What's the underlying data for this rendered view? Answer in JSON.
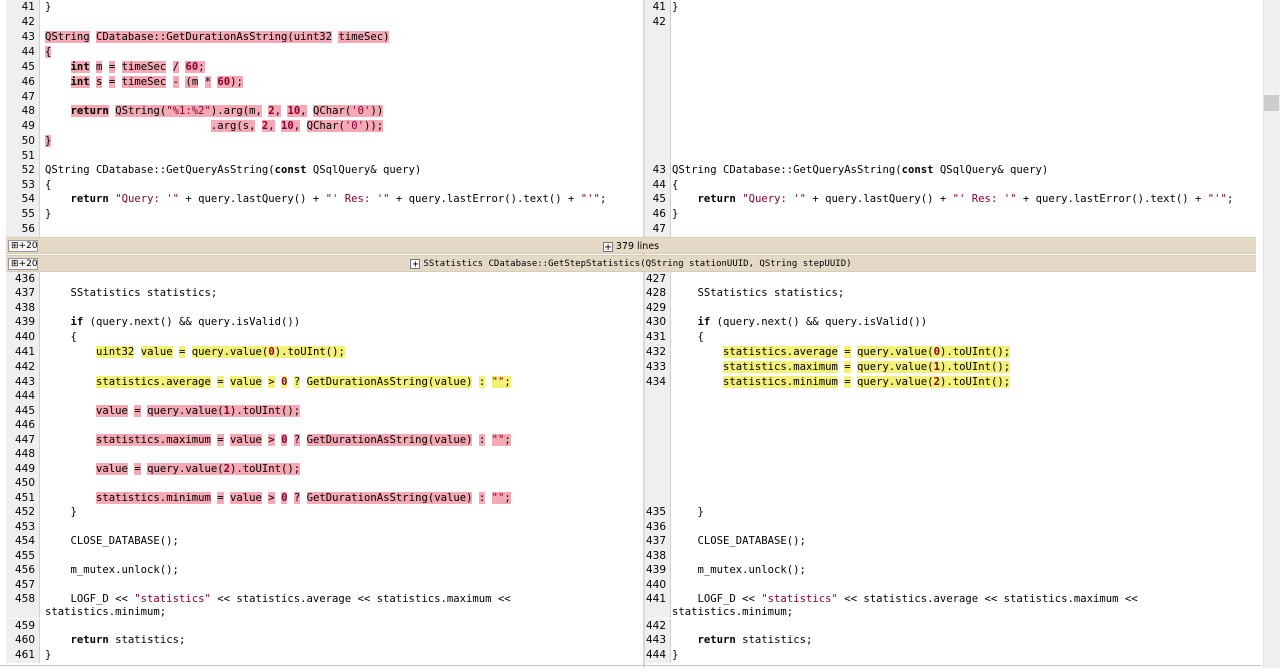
{
  "folds": {
    "top": {
      "expand_label": "+20",
      "text": "379 lines"
    },
    "func": {
      "expand_label": "+20",
      "text": "SStatistics CDatabase::GetStepStatistics(QString stationUUID, QString stepUUID)"
    }
  },
  "left_rows": [
    {
      "ln": "41",
      "text": "}"
    },
    {
      "ln": "42",
      "text": ""
    },
    {
      "ln": "43",
      "text": "QString CDatabase::GetDurationAsString(uint32 timeSec)"
    },
    {
      "ln": "44",
      "text": "{"
    },
    {
      "ln": "45",
      "text": "    int m = timeSec / 60;"
    },
    {
      "ln": "46",
      "text": "    int s = timeSec - (m * 60);"
    },
    {
      "ln": "47",
      "text": ""
    },
    {
      "ln": "48",
      "text": "    return QString(\"%1:%2\").arg(m, 2, 10, QChar('0'))"
    },
    {
      "ln": "49",
      "text": "                          .arg(s, 2, 10, QChar('0'));"
    },
    {
      "ln": "50",
      "text": "}"
    },
    {
      "ln": "51",
      "text": ""
    },
    {
      "ln": "52",
      "text": "QString CDatabase::GetQueryAsString(const QSqlQuery& query)"
    },
    {
      "ln": "53",
      "text": "{"
    },
    {
      "ln": "54",
      "text": "    return \"Query: '\" + query.lastQuery() + \"' Res: '\" + query.lastError().text() + \"'\";"
    },
    {
      "ln": "55",
      "text": "}"
    },
    {
      "ln": "56",
      "text": ""
    },
    {
      "ln": "436",
      "text": ""
    },
    {
      "ln": "437",
      "text": "    SStatistics statistics;"
    },
    {
      "ln": "438",
      "text": ""
    },
    {
      "ln": "439",
      "text": "    if (query.next() && query.isValid())"
    },
    {
      "ln": "440",
      "text": "    {"
    },
    {
      "ln": "441",
      "text": "        uint32 value = query.value(0).toUInt();"
    },
    {
      "ln": "442",
      "text": ""
    },
    {
      "ln": "443",
      "text": "        statistics.average = value > 0 ? GetDurationAsString(value) : \"\";"
    },
    {
      "ln": "444",
      "text": ""
    },
    {
      "ln": "445",
      "text": "        value = query.value(1).toUInt();"
    },
    {
      "ln": "446",
      "text": ""
    },
    {
      "ln": "447",
      "text": "        statistics.maximum = value > 0 ? GetDurationAsString(value) : \"\";"
    },
    {
      "ln": "448",
      "text": ""
    },
    {
      "ln": "449",
      "text": "        value = query.value(2).toUInt();"
    },
    {
      "ln": "450",
      "text": ""
    },
    {
      "ln": "451",
      "text": "        statistics.minimum = value > 0 ? GetDurationAsString(value) : \"\";"
    },
    {
      "ln": "452",
      "text": "    }"
    },
    {
      "ln": "453",
      "text": ""
    },
    {
      "ln": "454",
      "text": "    CLOSE_DATABASE();"
    },
    {
      "ln": "455",
      "text": ""
    },
    {
      "ln": "456",
      "text": "    m_mutex.unlock();"
    },
    {
      "ln": "457",
      "text": ""
    },
    {
      "ln": "458",
      "text": "    LOGF_D << \"statistics\" << statistics.average << statistics.maximum <<"
    },
    {
      "ln": "459",
      "text": ""
    },
    {
      "ln": "460",
      "text": "    return statistics;"
    },
    {
      "ln": "461",
      "text": "}"
    }
  ],
  "left_wrap_458": "statistics.minimum;",
  "right_rows": [
    {
      "ln": "41",
      "text": "}"
    },
    {
      "ln": "42",
      "text": ""
    },
    {
      "ln": "43",
      "text": "QString CDatabase::GetQueryAsString(const QSqlQuery& query)"
    },
    {
      "ln": "44",
      "text": "{"
    },
    {
      "ln": "45",
      "text": "    return \"Query: '\" + query.lastQuery() + \"' Res: '\" + query.lastError().text() + \"'\";"
    },
    {
      "ln": "46",
      "text": "}"
    },
    {
      "ln": "47",
      "text": ""
    },
    {
      "ln": "427",
      "text": ""
    },
    {
      "ln": "428",
      "text": "    SStatistics statistics;"
    },
    {
      "ln": "429",
      "text": ""
    },
    {
      "ln": "430",
      "text": "    if (query.next() && query.isValid())"
    },
    {
      "ln": "431",
      "text": "    {"
    },
    {
      "ln": "432",
      "text": "        statistics.average = query.value(0).toUInt();"
    },
    {
      "ln": "433",
      "text": "        statistics.maximum = query.value(1).toUInt();"
    },
    {
      "ln": "434",
      "text": "        statistics.minimum = query.value(2).toUInt();"
    },
    {
      "ln": "435",
      "text": "    }"
    },
    {
      "ln": "436",
      "text": ""
    },
    {
      "ln": "437",
      "text": "    CLOSE_DATABASE();"
    },
    {
      "ln": "438",
      "text": ""
    },
    {
      "ln": "439",
      "text": "    m_mutex.unlock();"
    },
    {
      "ln": "440",
      "text": ""
    },
    {
      "ln": "441",
      "text": "    LOGF_D << \"statistics\" << statistics.average << statistics.maximum <<"
    },
    {
      "ln": "442",
      "text": ""
    },
    {
      "ln": "443",
      "text": "    return statistics;"
    },
    {
      "ln": "444",
      "text": "}"
    }
  ],
  "right_wrap_441": "statistics.minimum;",
  "colors": {
    "deleted": "#f4a9b5",
    "changed": "#f4f178",
    "fold": "#e3d9c6",
    "gutter": "#efefef"
  }
}
